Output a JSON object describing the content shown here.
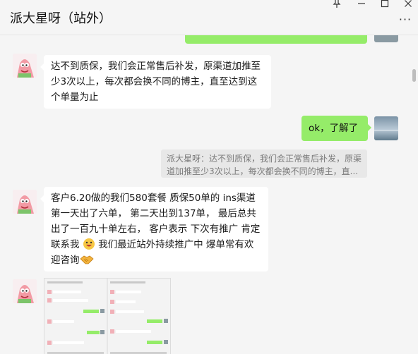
{
  "window": {
    "title": "派大星呀（站外）",
    "pin_icon": "pin-icon",
    "minimize_icon": "minimize-icon",
    "maximize_icon": "maximize-icon",
    "close_icon": "close-icon",
    "more_icon": "more-icon"
  },
  "messages": {
    "m1_text": "达不到质保，我们会正常售后补发，原渠道加推至少3次以上，每次都会换不同的博主，直至达到这个单量为止",
    "m2_text": "ok，了解了",
    "m2_quote": "派大星呀：达不到质保，我们会正常售后补发，原渠道加推至少3次以上，每次都会换不同的博主，直...",
    "m3_text_a": "客户6.20做的我们580套餐 质保50单的 ins渠道第一天出了六单， 第二天出到137单， 最后总共出了一百九十单左右， 客户表示 下次有推广 肯定联系我 ",
    "m3_text_b": " 我们最近站外持续推广中 爆单常有欢迎咨询"
  },
  "colors": {
    "self_bubble": "#95ec69",
    "other_bubble": "#ffffff",
    "background": "#f5f5f5"
  }
}
